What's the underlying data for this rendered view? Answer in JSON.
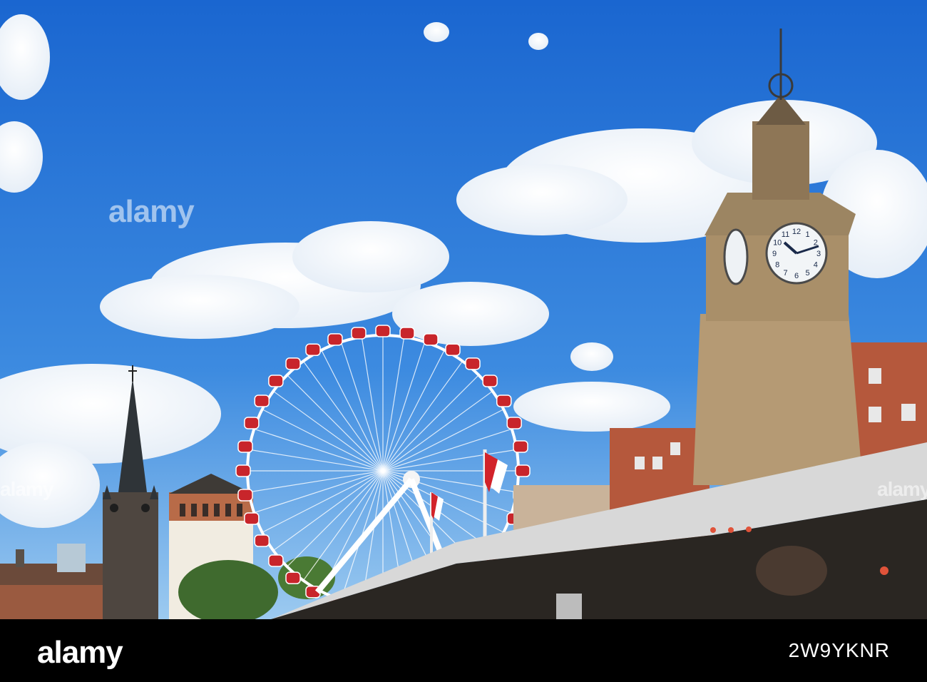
{
  "watermark": {
    "text": "alamy",
    "center_text": "alamy"
  },
  "footer": {
    "brand": "alamy",
    "image_id": "2W9YKNR"
  },
  "clock": {
    "dial_numerals": [
      "12",
      "1",
      "2",
      "3",
      "4",
      "5",
      "6",
      "7",
      "8",
      "9",
      "10",
      "11"
    ]
  },
  "colors": {
    "sky_top": "#1f6fd6",
    "sky_bottom": "#8ec4f0",
    "stone": "#b59a74",
    "gondola_red": "#c8252b",
    "brick": "#b5583c"
  }
}
